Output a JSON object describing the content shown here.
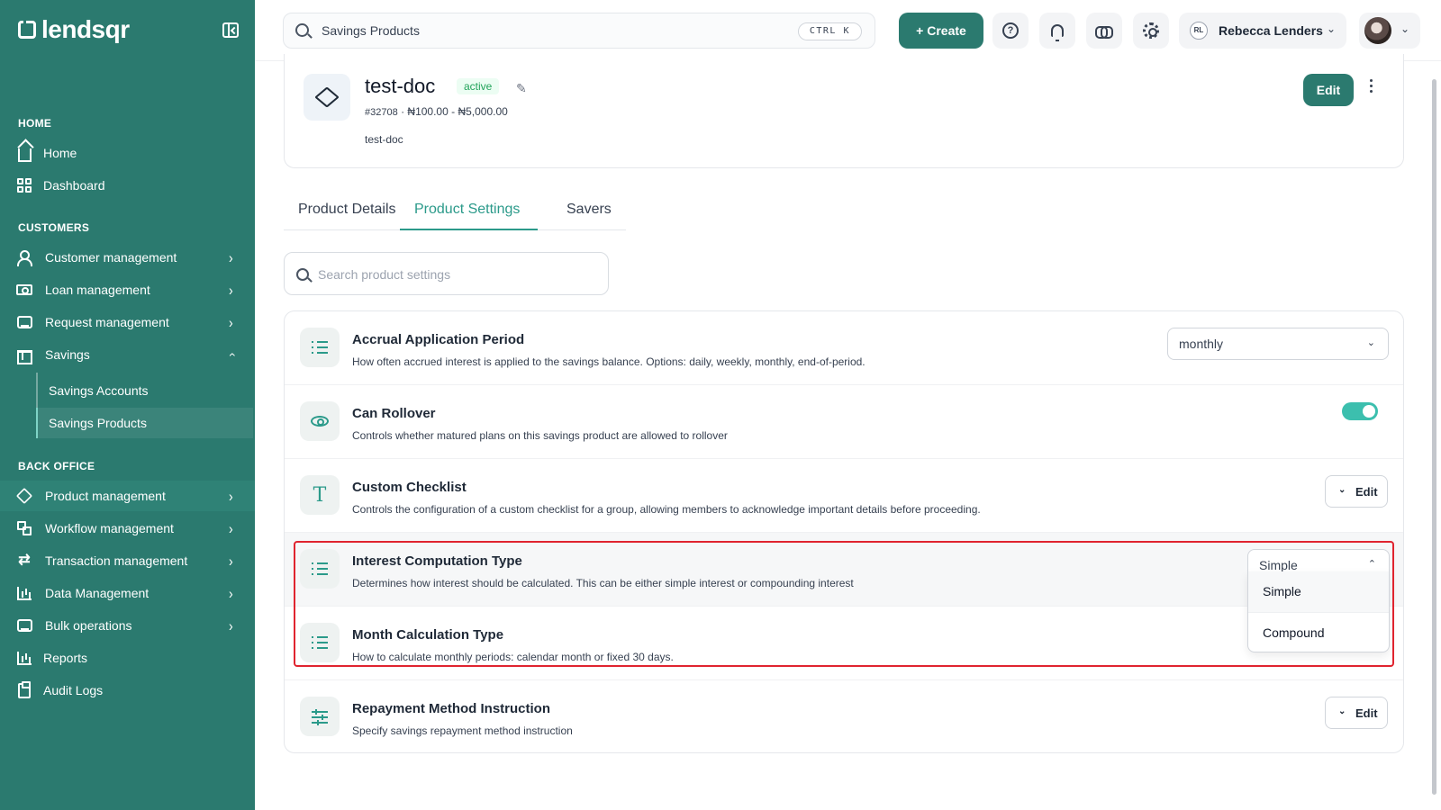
{
  "brand": {
    "name": "lendsqr"
  },
  "sidebar": {
    "sections": {
      "home": "HOME",
      "customers": "CUSTOMERS",
      "back_office": "BACK OFFICE"
    },
    "items": {
      "home": "Home",
      "dashboard": "Dashboard",
      "customer_management": "Customer management",
      "loan_management": "Loan management",
      "request_management": "Request management",
      "savings": "Savings",
      "savings_accounts": "Savings Accounts",
      "savings_products": "Savings Products",
      "product_management": "Product management",
      "workflow_management": "Workflow management",
      "transaction_management": "Transaction management",
      "data_management": "Data Management",
      "bulk_operations": "Bulk operations",
      "reports": "Reports",
      "audit_logs": "Audit Logs"
    }
  },
  "topbar": {
    "search_value": "Savings Products",
    "shortcut": "CTRL K",
    "create_label": "+ Create",
    "user_initials": "RL",
    "user_name": "Rebecca Lenders"
  },
  "product": {
    "name": "test-doc",
    "status": "active",
    "id": "#32708",
    "range": "₦100.00 - ₦5,000.00",
    "description": "test-doc",
    "edit_label": "Edit"
  },
  "tabs": {
    "details": "Product Details",
    "settings": "Product Settings",
    "savers": "Savers",
    "active": "settings"
  },
  "settings_search": {
    "placeholder": "Search product settings"
  },
  "settings": {
    "accrual": {
      "title": "Accrual Application Period",
      "desc": "How often accrued interest is applied to the savings balance. Options: daily, weekly, monthly, end-of-period.",
      "value": "monthly"
    },
    "rollover": {
      "title": "Can Rollover",
      "desc": "Controls whether matured plans on this savings product are allowed to rollover",
      "enabled": true
    },
    "checklist": {
      "title": "Custom Checklist",
      "desc": "Controls the configuration of a custom checklist for a group, allowing members to acknowledge important details before proceeding.",
      "edit_label": "Edit"
    },
    "interest": {
      "title": "Interest Computation Type",
      "desc": "Determines how interest should be calculated. This can be either simple interest or compounding interest",
      "value": "Simple",
      "options": [
        "Simple",
        "Compound"
      ]
    },
    "month": {
      "title": "Month Calculation Type",
      "desc": "How to calculate monthly periods: calendar month or fixed 30 days."
    },
    "repayment": {
      "title": "Repayment Method Instruction",
      "desc": "Specify savings repayment method instruction",
      "edit_label": "Edit"
    }
  },
  "colors": {
    "sidebar": "#2b7a6f",
    "accent": "#2b9a8a",
    "toggle": "#3cbfae",
    "highlight_box": "#e0242f"
  }
}
